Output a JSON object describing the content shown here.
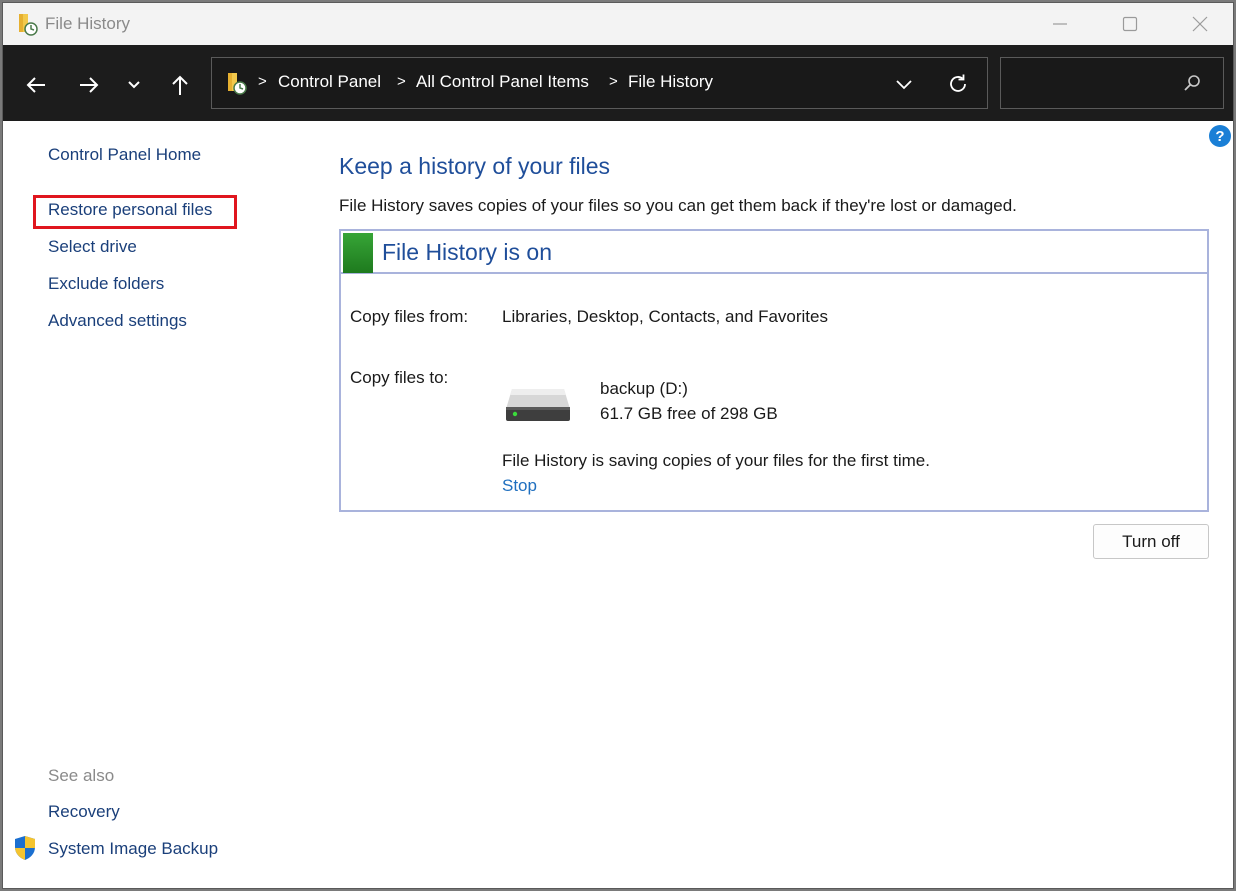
{
  "window": {
    "title": "File History"
  },
  "titlebar": {
    "icons": [
      "file-history-icon",
      "minimize-icon",
      "maximize-icon",
      "close-icon"
    ]
  },
  "navbar": {
    "icons": [
      "back-arrow-icon",
      "forward-arrow-icon",
      "recent-locations-chevron-icon",
      "up-arrow-icon"
    ],
    "breadcrumb": [
      "Control Panel",
      "All Control Panel Items",
      "File History"
    ],
    "breadcrumb_separator": ">",
    "address_icons": [
      "folder-icon",
      "chevron-down-icon",
      "refresh-icon"
    ],
    "search": {
      "value": "",
      "placeholder": "",
      "icon": "search-icon"
    }
  },
  "sidebar": {
    "home_label": "Control Panel Home",
    "tasks": [
      {
        "label": "Restore personal files",
        "highlighted": true
      },
      {
        "label": "Select drive"
      },
      {
        "label": "Exclude folders"
      },
      {
        "label": "Advanced settings"
      }
    ],
    "see_also_label": "See also",
    "see_also": [
      {
        "label": "Recovery"
      },
      {
        "label": "System Image Backup",
        "icon": "uac-shield-icon"
      }
    ],
    "highlight_color": "#e0161e"
  },
  "main": {
    "heading": "Keep a history of your files",
    "description": "File History saves copies of your files so you can get them back if they're lost or damaged.",
    "help_icon": "help-icon",
    "status": {
      "title": "File History is on",
      "status_color": "#2e9a2e",
      "copy_from_label": "Copy files from:",
      "copy_from_value": "Libraries, Desktop, Contacts, and Favorites",
      "copy_to_label": "Copy files to:",
      "drive_name": "backup (D:)",
      "drive_free": "61.7 GB free of 298 GB",
      "progress_text": "File History is saving copies of your files for the first time.",
      "stop_label": "Stop"
    },
    "turn_off_label": "Turn off"
  }
}
